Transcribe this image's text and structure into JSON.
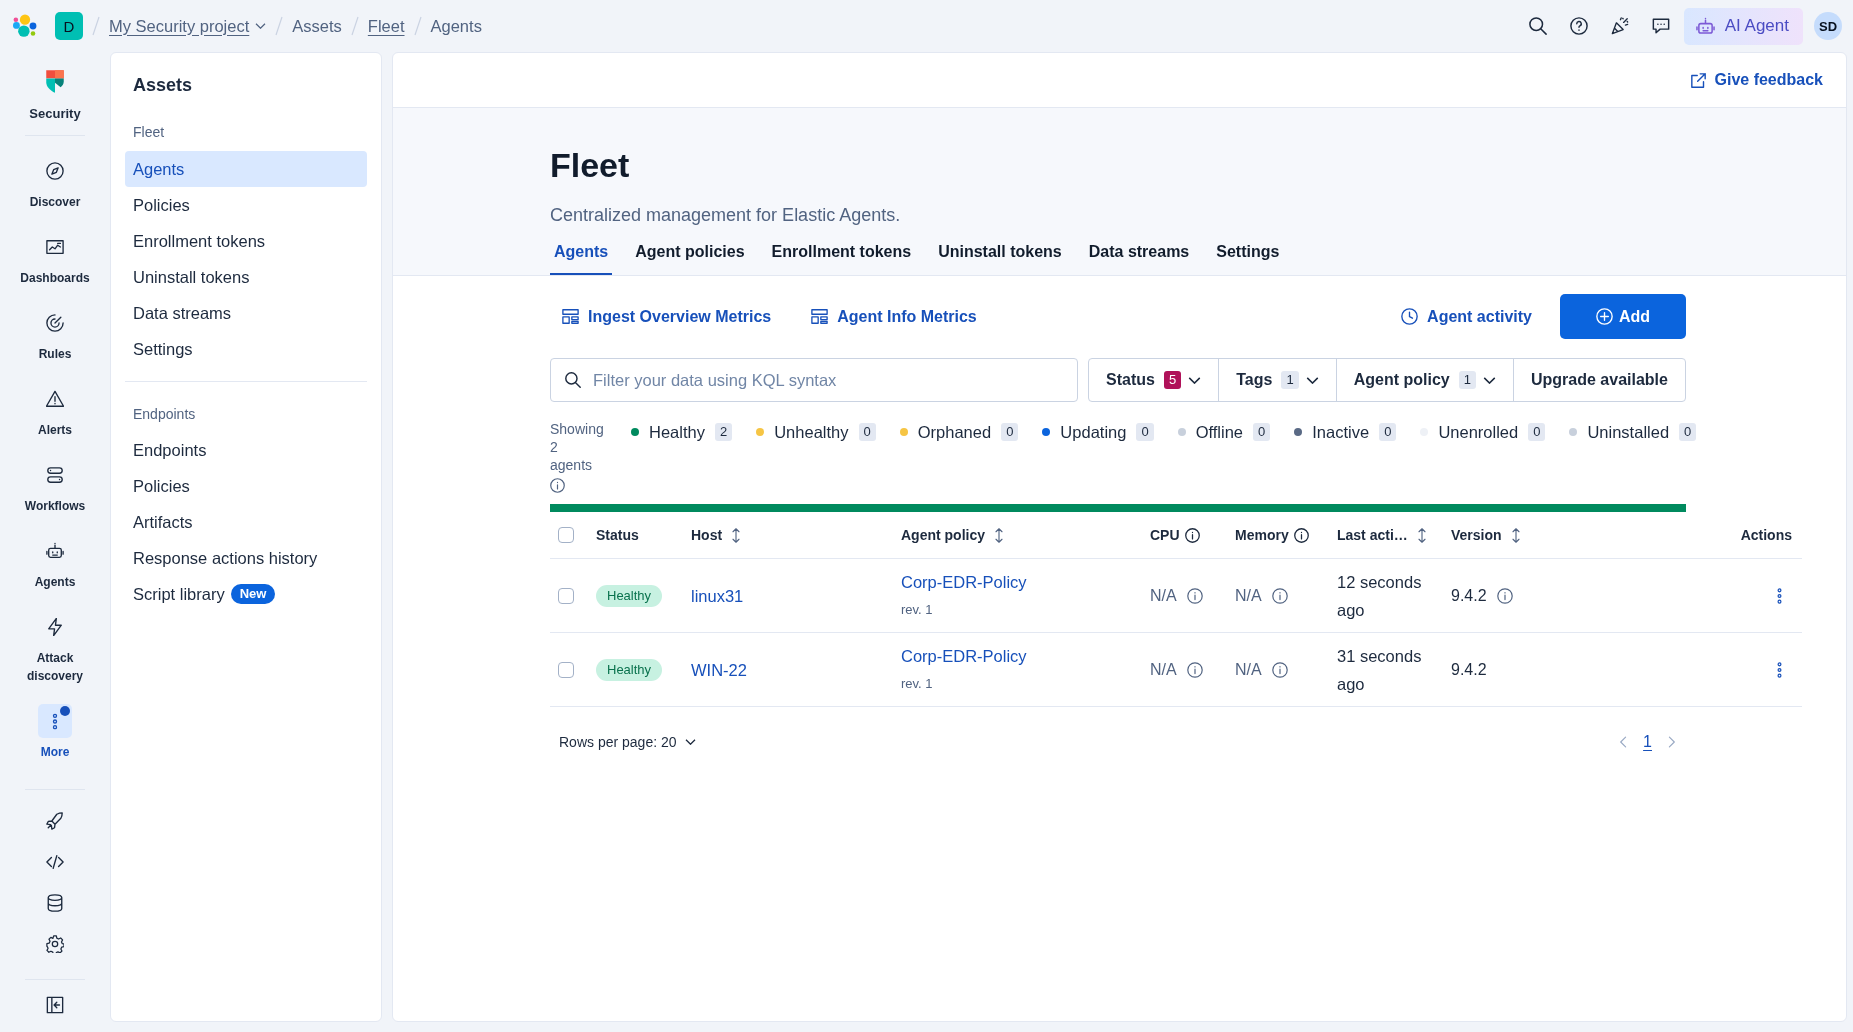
{
  "top_bar": {
    "project_badge": "D",
    "breadcrumbs": [
      {
        "label": "My Security project",
        "link": true,
        "dropdown": true
      },
      {
        "label": "Assets",
        "link": false,
        "dropdown": false
      },
      {
        "label": "Fleet",
        "link": true,
        "dropdown": false
      },
      {
        "label": "Agents",
        "link": false,
        "dropdown": false
      }
    ],
    "ai_agent_button": "AI Agent",
    "user_avatar": "SD"
  },
  "nav_rail": {
    "items": [
      {
        "label": "Security",
        "kind": "logo",
        "selected": false,
        "notification": false
      },
      {
        "label": "Discover",
        "kind": "item",
        "selected": false,
        "notification": false
      },
      {
        "label": "Dashboards",
        "kind": "item",
        "selected": false,
        "notification": false
      },
      {
        "label": "Rules",
        "kind": "item",
        "selected": false,
        "notification": false
      },
      {
        "label": "Alerts",
        "kind": "item",
        "selected": false,
        "notification": false
      },
      {
        "label": "Workflows",
        "kind": "item",
        "selected": false,
        "notification": false
      },
      {
        "label": "Agents",
        "kind": "item",
        "selected": false,
        "notification": false
      },
      {
        "label": "Attack discovery",
        "kind": "item",
        "selected": false,
        "notification": false
      },
      {
        "label": "More",
        "kind": "item",
        "selected": true,
        "notification": true
      }
    ]
  },
  "sidebar": {
    "title": "Assets",
    "groups": [
      {
        "label": "Fleet",
        "items": [
          {
            "label": "Agents",
            "selected": true
          },
          {
            "label": "Policies",
            "selected": false
          },
          {
            "label": "Enrollment tokens",
            "selected": false
          },
          {
            "label": "Uninstall tokens",
            "selected": false
          },
          {
            "label": "Data streams",
            "selected": false
          },
          {
            "label": "Settings",
            "selected": false
          }
        ]
      },
      {
        "label": "Endpoints",
        "items": [
          {
            "label": "Endpoints",
            "selected": false
          },
          {
            "label": "Policies",
            "selected": false
          },
          {
            "label": "Artifacts",
            "selected": false
          },
          {
            "label": "Response actions history",
            "selected": false
          },
          {
            "label": "Script library",
            "selected": false,
            "badge": "New"
          }
        ]
      }
    ]
  },
  "main": {
    "feedback_link": "Give feedback",
    "title": "Fleet",
    "subtitle": "Centralized management for Elastic Agents.",
    "tabs": [
      {
        "label": "Agents",
        "selected": true
      },
      {
        "label": "Agent policies",
        "selected": false
      },
      {
        "label": "Enrollment tokens",
        "selected": false
      },
      {
        "label": "Uninstall tokens",
        "selected": false
      },
      {
        "label": "Data streams",
        "selected": false
      },
      {
        "label": "Settings",
        "selected": false
      }
    ]
  },
  "toolbar": {
    "metric_links": [
      "Ingest Overview Metrics",
      "Agent Info Metrics"
    ],
    "activity_link": "Agent activity",
    "add_button": "Add"
  },
  "filters": {
    "search": {
      "placeholder": "Filter your data using KQL syntax"
    },
    "dropdowns": [
      {
        "label": "Status",
        "count": "5",
        "active": true
      },
      {
        "label": "Tags",
        "count": "1",
        "active": false
      },
      {
        "label": "Agent policy",
        "count": "1",
        "active": false
      }
    ],
    "upgrade_button": "Upgrade available"
  },
  "status_summary": {
    "showing": "Showing 2 agents",
    "statuses": [
      {
        "label": "Healthy",
        "count": "2",
        "color": "#008a5e"
      },
      {
        "label": "Unhealthy",
        "count": "0",
        "color": "#f6c544"
      },
      {
        "label": "Orphaned",
        "count": "0",
        "color": "#f6c544"
      },
      {
        "label": "Updating",
        "count": "0",
        "color": "#0b64dd"
      },
      {
        "label": "Offline",
        "count": "0",
        "color": "#c8d0dc"
      },
      {
        "label": "Inactive",
        "count": "0",
        "color": "#5a6a85"
      },
      {
        "label": "Unenrolled",
        "count": "0",
        "color": "#eef1f6"
      },
      {
        "label": "Uninstalled",
        "count": "0",
        "color": "#c8d0dc"
      }
    ]
  },
  "table": {
    "select_all_checked": false,
    "columns": [
      {
        "label": "Status",
        "sortable": false,
        "info": false
      },
      {
        "label": "Host",
        "sortable": true,
        "info": false
      },
      {
        "label": "Agent policy",
        "sortable": true,
        "info": false
      },
      {
        "label": "CPU",
        "sortable": false,
        "info": true
      },
      {
        "label": "Memory",
        "sortable": false,
        "info": true
      },
      {
        "label": "Last acti…",
        "sortable": true,
        "info": false
      },
      {
        "label": "Version",
        "sortable": true,
        "info": false
      },
      {
        "label": "Actions",
        "sortable": false,
        "info": false
      }
    ],
    "rows": [
      {
        "checked": false,
        "status": "Healthy",
        "host": "linux31",
        "policy": "Corp-EDR-Policy",
        "policy_revision": "rev. 1",
        "cpu": "N/A",
        "memory": "N/A",
        "last_activity": "12 seconds ago",
        "version": "9.4.2",
        "version_info": true
      },
      {
        "checked": false,
        "status": "Healthy",
        "host": "WIN-22",
        "policy": "Corp-EDR-Policy",
        "policy_revision": "rev. 1",
        "cpu": "N/A",
        "memory": "N/A",
        "last_activity": "31 seconds ago",
        "version": "9.4.2",
        "version_info": false
      }
    ]
  },
  "pagination": {
    "rows_per_page": "Rows per page: 20",
    "pages": [
      {
        "label": "1",
        "selected": true
      }
    ]
  }
}
